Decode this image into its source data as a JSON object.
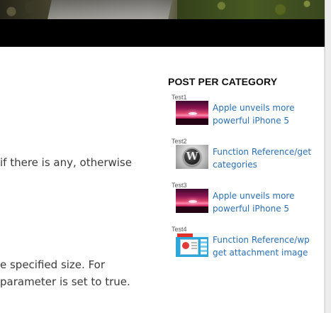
{
  "content": {
    "line1": "if there is any, otherwise",
    "line2": "e specified size. For",
    "line3": "parameter is set to true."
  },
  "sidebar": {
    "widget_title": "POST PER CATEGORY",
    "categories": [
      {
        "label": "Test1",
        "post_title": "Apple unveils more powerful iPhone 5",
        "thumb_icon": "sunset-thumbnail"
      },
      {
        "label": "Test2",
        "post_title": "Function Reference/get categories",
        "thumb_icon": "wordpress-logo-thumbnail"
      },
      {
        "label": "Test3",
        "post_title": "Apple unveils more powerful iPhone 5",
        "thumb_icon": "sunset-thumbnail"
      },
      {
        "label": "Test4",
        "post_title": "Function Reference/wp get attachment image",
        "thumb_icon": "attachment-screenshot-thumbnail"
      }
    ]
  },
  "colors": {
    "link": "#2a6fb3",
    "nav_background": "#000000",
    "body_text": "#3a3a3a"
  }
}
